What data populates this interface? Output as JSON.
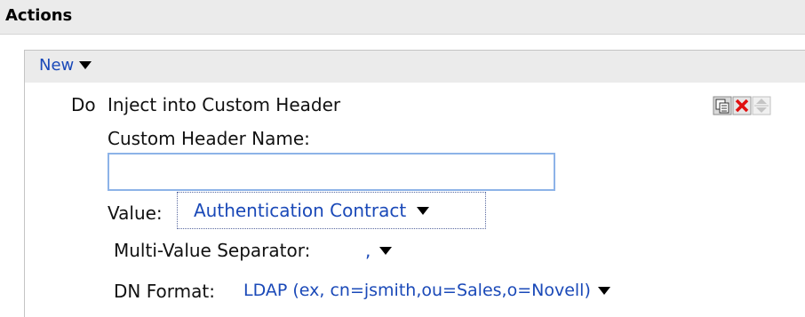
{
  "header": {
    "title": "Actions"
  },
  "toolbar": {
    "new_label": "New"
  },
  "action": {
    "do_label": "Do",
    "name": "Inject into Custom Header",
    "custom_header_label": "Custom Header Name:",
    "custom_header_value": "",
    "value_label": "Value:",
    "value_selected": "Authentication Contract",
    "mvs_label": "Multi-Value Separator:",
    "mvs_selected": ",",
    "dn_label": "DN Format:",
    "dn_selected": "LDAP (ex, cn=jsmith,ou=Sales,o=Novell)"
  },
  "icons": {
    "copy": "copy-icon",
    "delete": "delete-icon",
    "move": "move-up-down-icon"
  },
  "colors": {
    "link": "#1a49b8",
    "header_bg": "#ebebeb",
    "delete_red": "#e01010"
  }
}
